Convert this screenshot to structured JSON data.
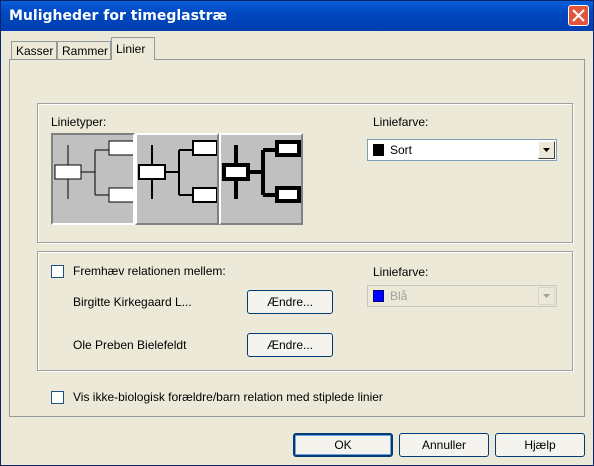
{
  "window": {
    "title": "Muligheder for timeglastræ"
  },
  "tabs": [
    {
      "label": "Kasser"
    },
    {
      "label": "Rammer"
    },
    {
      "label": "Linier"
    }
  ],
  "line_types": {
    "label": "Linietyper:",
    "options": [
      "thin-line-style",
      "medium-line-style",
      "thick-line-style"
    ],
    "selected_index": 0,
    "color_label": "Liniefarve:",
    "color_value": "Sort",
    "color_hex": "#000000"
  },
  "highlight": {
    "checkbox_label": "Fremhæv relationen mellem:",
    "checked": false,
    "person1": "Birgitte Kirkegaard L...",
    "person2": "Ole Preben Bielefeldt",
    "change_label": "Ændre...",
    "color_label": "Liniefarve:",
    "color_value": "Blå",
    "color_hex": "#0000ff"
  },
  "nonbio": {
    "checkbox_label": "Vis ikke-biologisk forældre/barn relation med stiplede linier",
    "checked": false
  },
  "footer": {
    "ok": "OK",
    "cancel": "Annuller",
    "help": "Hjælp"
  }
}
